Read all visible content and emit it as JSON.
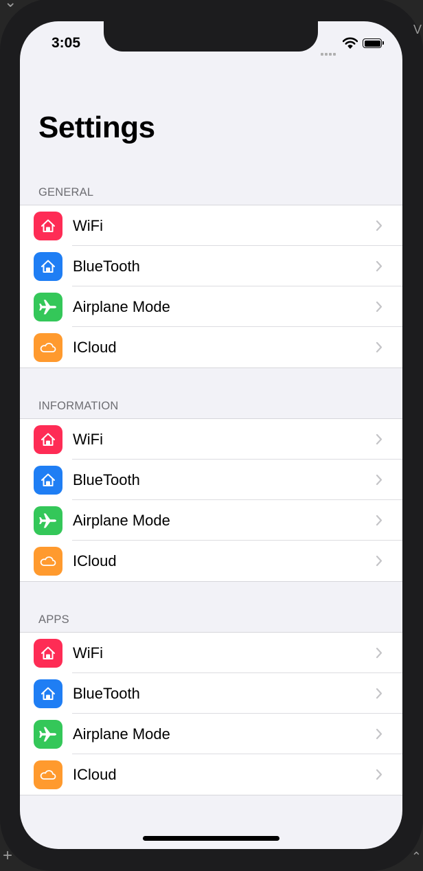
{
  "status_bar": {
    "time": "3:05"
  },
  "title": "Settings",
  "colors": {
    "wifi": "#fe2c55",
    "bluetooth": "#1f7ef4",
    "airplane": "#34c759",
    "icloud": "#ff9a2e",
    "background": "#f2f2f7"
  },
  "sections": [
    {
      "header": "GENERAL",
      "items": [
        {
          "label": "WiFi",
          "icon": "home-icon"
        },
        {
          "label": "BlueTooth",
          "icon": "home-icon"
        },
        {
          "label": "Airplane Mode",
          "icon": "airplane-icon"
        },
        {
          "label": "ICloud",
          "icon": "cloud-icon"
        }
      ]
    },
    {
      "header": "INFORMATION",
      "items": [
        {
          "label": "WiFi",
          "icon": "home-icon"
        },
        {
          "label": "BlueTooth",
          "icon": "home-icon"
        },
        {
          "label": "Airplane Mode",
          "icon": "airplane-icon"
        },
        {
          "label": "ICloud",
          "icon": "cloud-icon"
        }
      ]
    },
    {
      "header": "APPS",
      "items": [
        {
          "label": "WiFi",
          "icon": "home-icon"
        },
        {
          "label": "BlueTooth",
          "icon": "home-icon"
        },
        {
          "label": "Airplane Mode",
          "icon": "airplane-icon"
        },
        {
          "label": "ICloud",
          "icon": "cloud-icon"
        }
      ]
    }
  ]
}
